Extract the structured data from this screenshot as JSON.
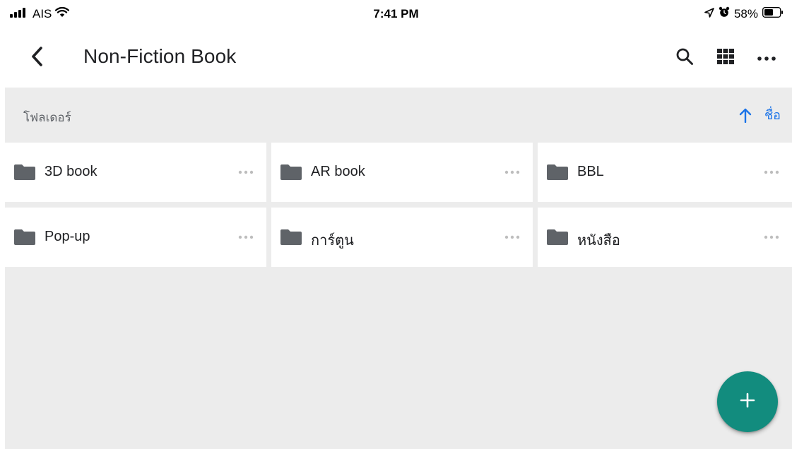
{
  "status_bar": {
    "carrier": "AIS",
    "time": "7:41 PM",
    "battery": "58%",
    "icons": [
      "signal-icon",
      "wifi-icon",
      "location-icon",
      "alarm-icon",
      "battery-icon"
    ]
  },
  "app_bar": {
    "title": "Non-Fiction Book",
    "icons": [
      "back-icon",
      "search-icon",
      "grid-view-icon",
      "more-icon"
    ]
  },
  "section": {
    "title": "โฟลเดอร์",
    "sort_label": "ชื่อ",
    "sort_icon": "arrow-up-icon"
  },
  "folders": [
    {
      "name": "3D book"
    },
    {
      "name": "AR book"
    },
    {
      "name": "BBL"
    },
    {
      "name": "Pop-up"
    },
    {
      "name": "การ์ตูน"
    },
    {
      "name": "หนังสือ"
    }
  ],
  "fab": {
    "icon": "plus-icon"
  },
  "colors": {
    "accent": "#1a73e8",
    "fab": "#128c7e",
    "surface": "#ececec",
    "folder": "#5f6368"
  }
}
